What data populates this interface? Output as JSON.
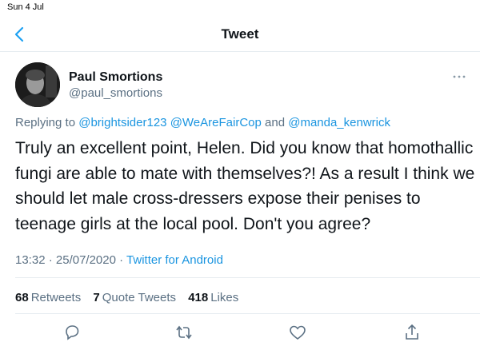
{
  "status_bar": {
    "time": "Sun 4 Jul"
  },
  "nav": {
    "back_icon": "chevron-left-icon",
    "title": "Tweet"
  },
  "author": {
    "name": "Paul Smortions",
    "handle": "@paul_smortions",
    "avatar": "profile-photo"
  },
  "reply": {
    "prefix": "Replying to",
    "mentions": [
      "@brightsider123",
      "@WeAreFairCop",
      "@manda_kenwrick"
    ],
    "conjunction": "and"
  },
  "tweet": {
    "lines": [
      "Truly an excellent point, Helen. Did you know that homothallic",
      "fungi are able to mate with themselves?! As a result I think we",
      "should let male cross-dressers expose their penises to",
      "teenage girls at the local pool. Don't you agree?"
    ]
  },
  "meta": {
    "time": "13:32",
    "separator": "·",
    "date": "25/07/2020",
    "source": "Twitter for Android"
  },
  "stats": {
    "retweets_count": "68",
    "retweets_label": "Retweets",
    "quotes_count": "7",
    "quotes_label": "Quote Tweets",
    "likes_count": "418",
    "likes_label": "Likes"
  },
  "actions": [
    "reply-icon",
    "retweet-icon",
    "like-icon",
    "share-icon"
  ],
  "colors": {
    "link": "#1b95e0",
    "secondary": "#5b7083",
    "text": "#0f1419",
    "divider": "#e6ecf0"
  }
}
